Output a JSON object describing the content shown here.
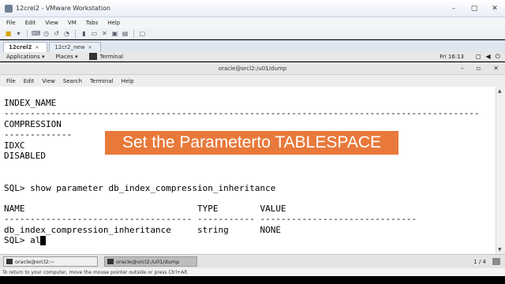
{
  "vmware": {
    "title": "12crel2 - VMware Workstation",
    "menu": [
      "File",
      "Edit",
      "View",
      "VM",
      "Tabs",
      "Help"
    ],
    "tabs": [
      {
        "label": "12crel2",
        "active": true
      },
      {
        "label": "12cr2_new",
        "active": false
      }
    ],
    "hint": "To return to your computer, move the mouse pointer outside or press Ctrl+Alt."
  },
  "gnome": {
    "applications": "Applications ▾",
    "places": "Places ▾",
    "terminal_app": "Terminal",
    "clock": "Fri 16:13"
  },
  "terminal": {
    "title": "oracle@orcl2:/u01/dump",
    "menu": [
      "File",
      "Edit",
      "View",
      "Search",
      "Terminal",
      "Help"
    ],
    "lines": [
      "INDEX_NAME",
      "-------------------------------------------------------------------------------------------",
      "COMPRESSION",
      "-------------",
      "IDXC",
      "DISABLED",
      "",
      "SQL> show parameter db_index_compression_inheritance",
      "",
      "NAME                                 TYPE        VALUE",
      "------------------------------------ ----------- ------------------------------",
      "db_index_compression_inheritance     string      NONE",
      "SQL> al"
    ]
  },
  "overlay": {
    "caption": "Set the Parameterto TABLESPACE"
  },
  "taskbar": {
    "items": [
      "oracle@orcl2:~",
      "oracle@orcl2:/u01/dump"
    ],
    "pager": "1 / 4"
  }
}
